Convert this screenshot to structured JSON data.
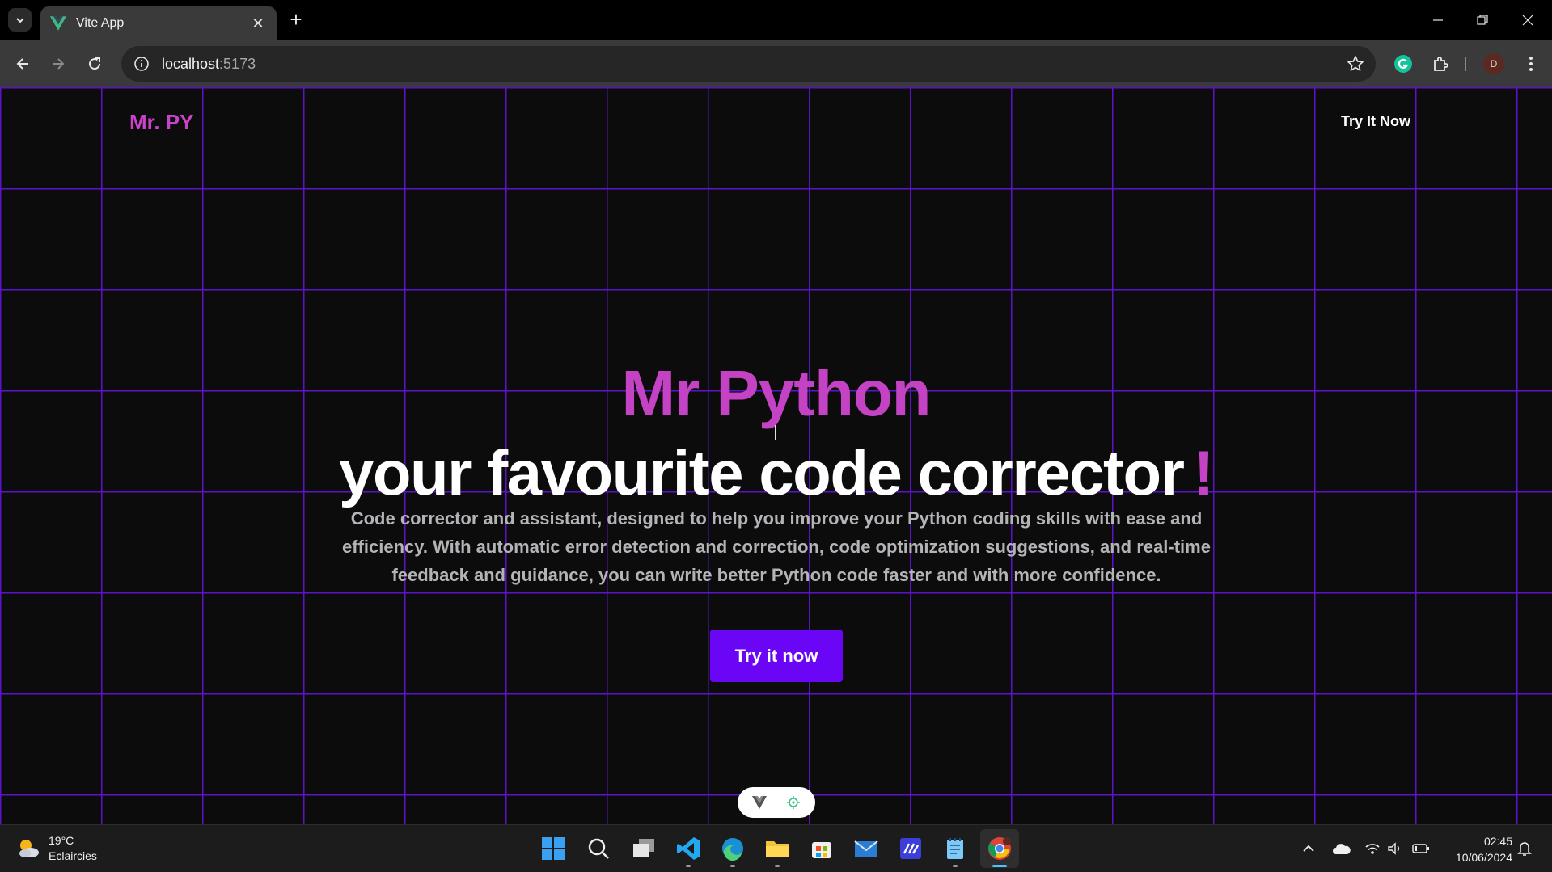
{
  "browser": {
    "tab_title": "Vite App",
    "url_host": "localhost",
    "url_port": ":5173",
    "profile_initial": "D"
  },
  "site": {
    "logo": "Mr. PY",
    "nav_cta": "Try It Now",
    "hero_title": "Mr Python",
    "hero_subtitle": "your favourite code corrector",
    "hero_subtitle_mark": "!",
    "hero_description": "Code corrector and assistant, designed to help you improve your Python coding skills with ease and efficiency. With automatic error detection and correction, code optimization suggestions, and real-time feedback and guidance, you can write better Python code faster and with more confidence.",
    "hero_button": "Try it now"
  },
  "taskbar": {
    "weather_temp": "19°C",
    "weather_desc": "Eclaircies",
    "time": "02:45",
    "date": "10/06/2024"
  },
  "colors": {
    "accent_magenta": "#c443c4",
    "accent_purple": "#6a06f5",
    "grid_line": "#5d13c9",
    "background": "#0c0c0c"
  },
  "icons": [
    "tab-search-icon",
    "vue-favicon",
    "close-icon",
    "plus-icon",
    "minimize-icon",
    "restore-icon",
    "window-close-icon",
    "back-icon",
    "forward-icon",
    "reload-icon",
    "site-info-icon",
    "bookmark-star-icon",
    "grammarly-icon",
    "extensions-icon",
    "more-icon",
    "weather-icon",
    "windows-start-icon",
    "search-icon",
    "task-view-icon",
    "vscode-icon",
    "edge-icon",
    "file-explorer-icon",
    "store-icon",
    "mail-icon",
    "tasks-icon",
    "notepad-icon",
    "chrome-icon",
    "tray-chevron-icon",
    "onedrive-icon",
    "wifi-icon",
    "volume-icon",
    "battery-icon",
    "notification-bell-icon"
  ]
}
